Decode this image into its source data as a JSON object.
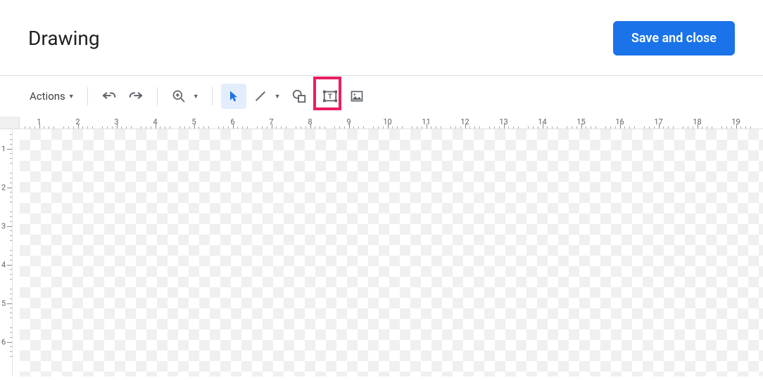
{
  "dialog": {
    "title": "Drawing",
    "save_label": "Save and close"
  },
  "toolbar": {
    "actions_label": "Actions",
    "tools": {
      "undo": "Undo",
      "redo": "Redo",
      "zoom": "Zoom",
      "select": "Select",
      "line": "Line",
      "shape": "Shape",
      "textbox": "Text box",
      "image": "Image"
    }
  },
  "highlight": {
    "target": "textbox"
  },
  "ruler": {
    "horizontal": [
      1,
      2,
      3,
      4,
      5,
      6,
      7,
      8,
      9,
      10,
      11,
      12,
      13,
      14,
      15,
      16,
      17,
      18,
      19
    ],
    "vertical": [
      1,
      2,
      3,
      4,
      5,
      6
    ]
  }
}
